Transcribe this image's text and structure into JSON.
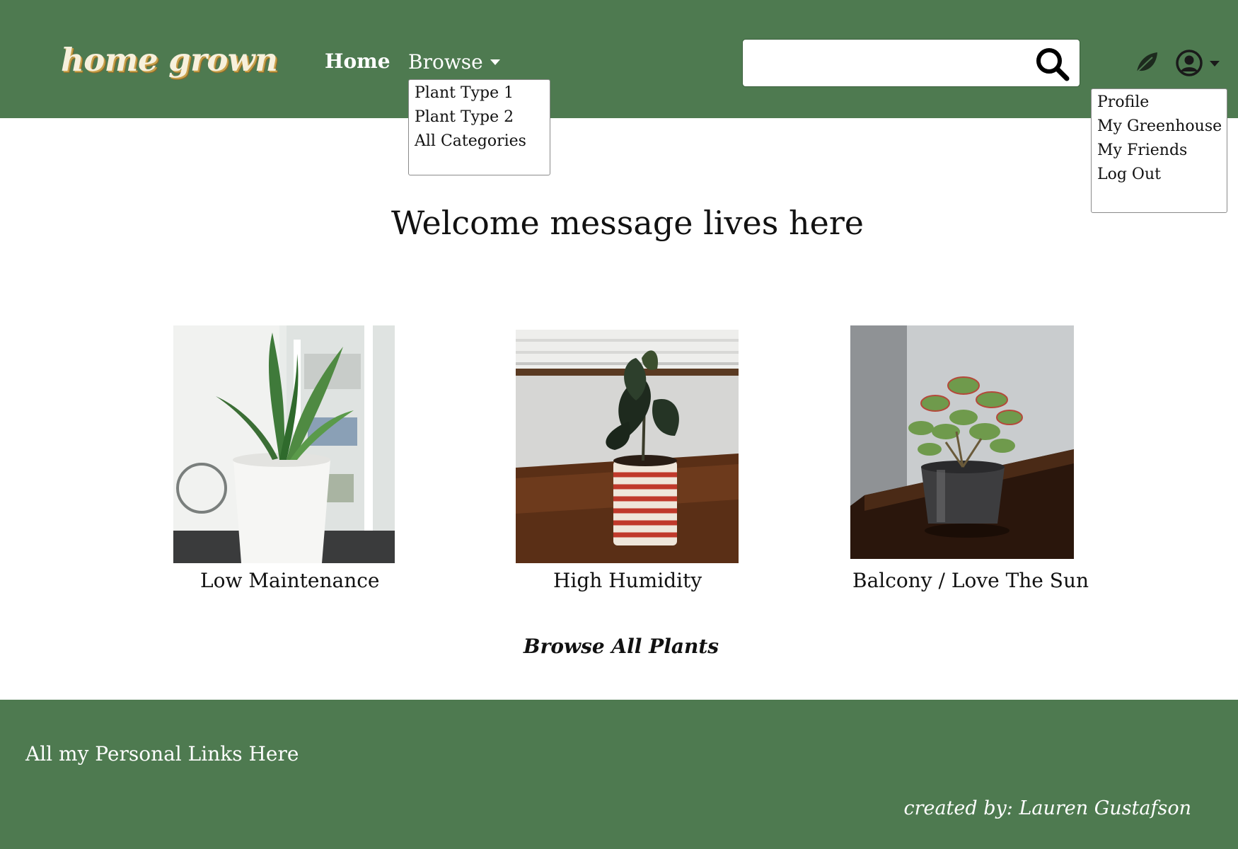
{
  "header": {
    "logo": "home grown",
    "nav": {
      "home": "Home",
      "browse": "Browse"
    },
    "browse_menu": [
      "Plant Type 1",
      "Plant Type 2",
      "All Categories"
    ],
    "search": {
      "placeholder": ""
    },
    "user_menu": [
      "Profile",
      "My Greenhouse",
      "My Friends",
      "Log Out"
    ],
    "icons": {
      "search": "search-icon",
      "leaf": "leaf-icon",
      "user": "user-circle-icon",
      "caret": "caret-down-icon"
    }
  },
  "main": {
    "welcome": "Welcome message lives here",
    "categories": [
      {
        "label": "Low Maintenance"
      },
      {
        "label": "High Humidity"
      },
      {
        "label": "Balcony / Love The Sun"
      }
    ],
    "browse_all": "Browse All Plants"
  },
  "footer": {
    "links": "All my Personal Links Here",
    "credit": "created by: Lauren Gustafson"
  },
  "colors": {
    "brand_green": "#4e7a50",
    "logo_cream": "#f7f0dc",
    "logo_gold": "#c9a14a"
  }
}
